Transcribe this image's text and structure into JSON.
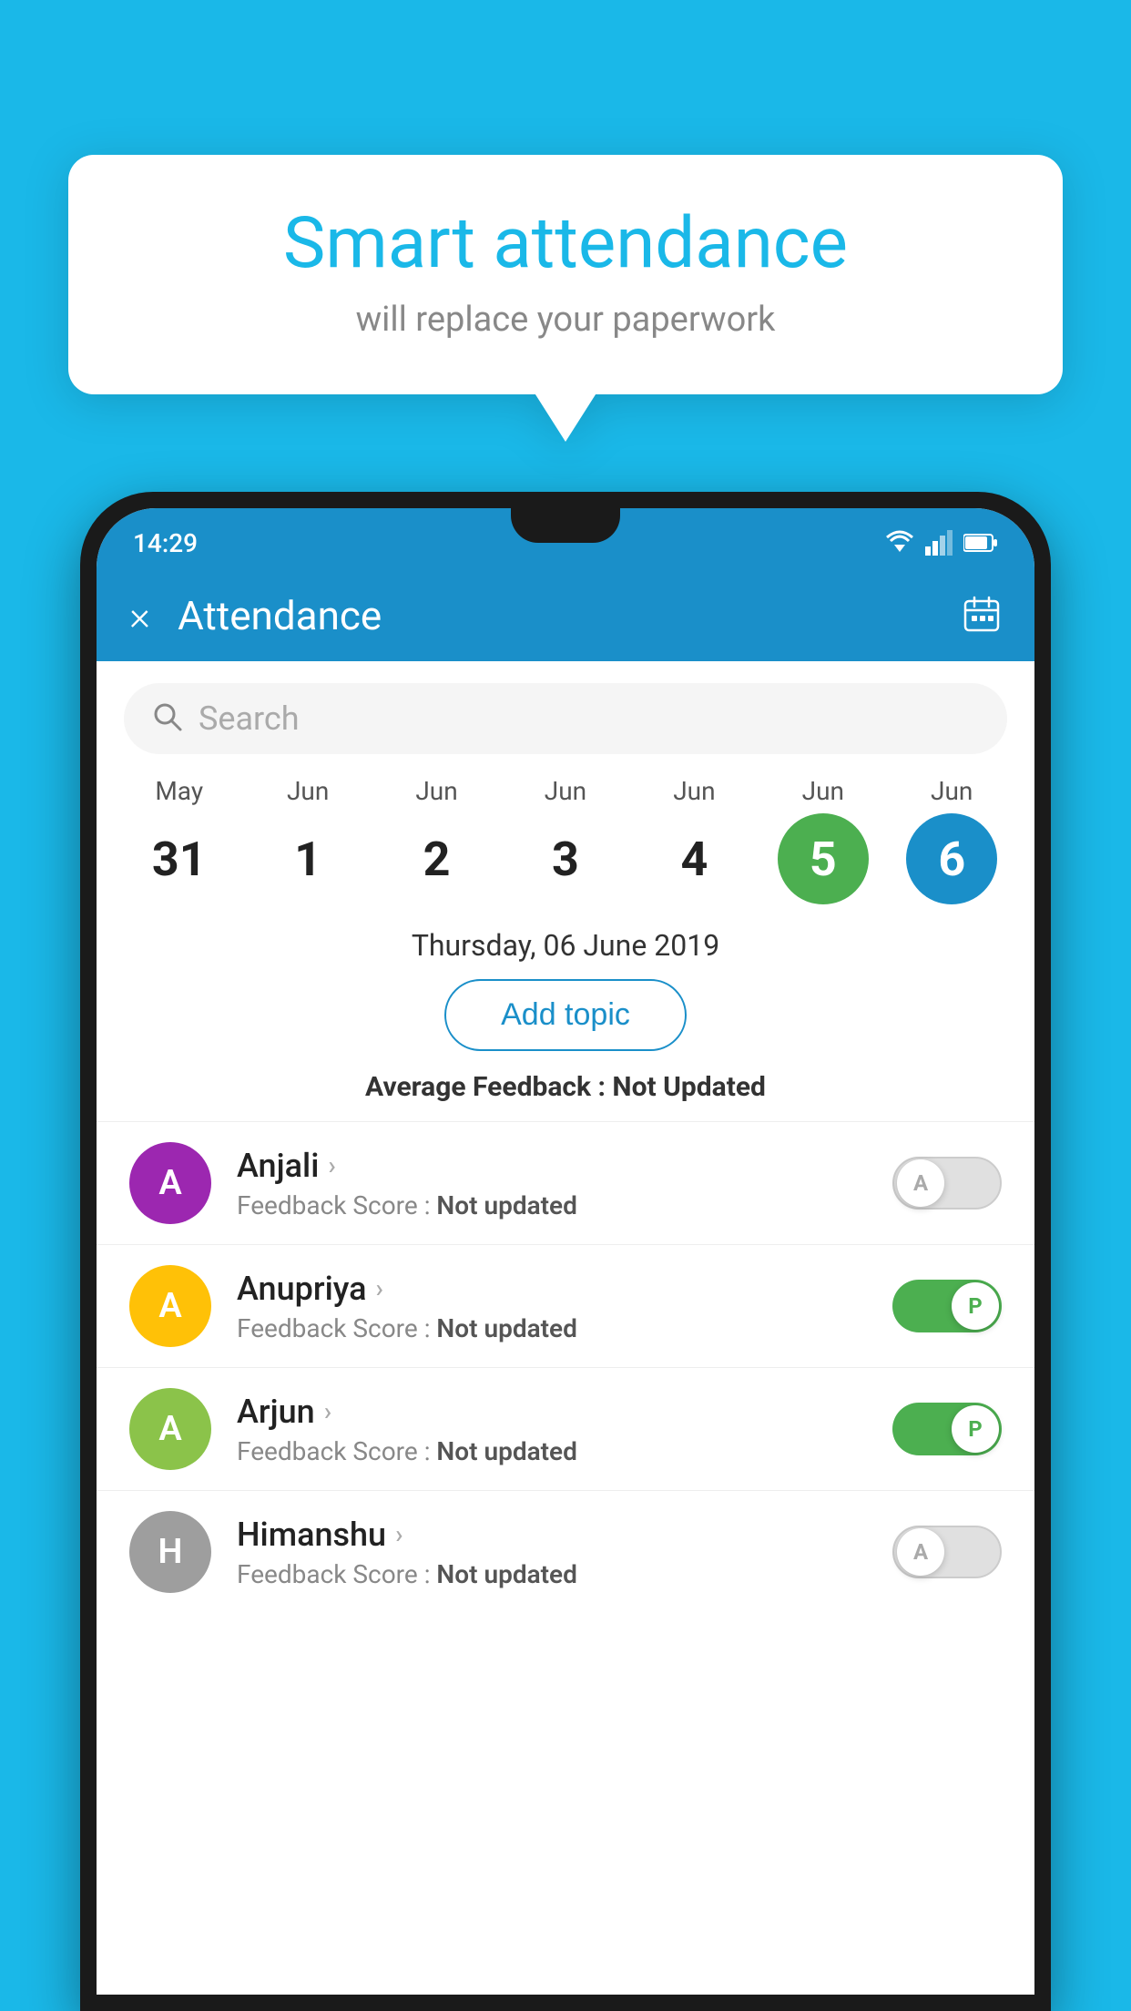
{
  "background": {
    "color": "#1ab8e8"
  },
  "bubble": {
    "title": "Smart attendance",
    "subtitle": "will replace your paperwork"
  },
  "status_bar": {
    "time": "14:29"
  },
  "header": {
    "title": "Attendance",
    "close_label": "×",
    "calendar_icon": "calendar-icon"
  },
  "search": {
    "placeholder": "Search"
  },
  "calendar": {
    "days": [
      {
        "month": "May",
        "date": "31",
        "state": "normal"
      },
      {
        "month": "Jun",
        "date": "1",
        "state": "normal"
      },
      {
        "month": "Jun",
        "date": "2",
        "state": "normal"
      },
      {
        "month": "Jun",
        "date": "3",
        "state": "normal"
      },
      {
        "month": "Jun",
        "date": "4",
        "state": "normal"
      },
      {
        "month": "Jun",
        "date": "5",
        "state": "green"
      },
      {
        "month": "Jun",
        "date": "6",
        "state": "blue"
      }
    ],
    "selected_date": "Thursday, 06 June 2019"
  },
  "add_topic": {
    "label": "Add topic"
  },
  "avg_feedback": {
    "label": "Average Feedback : ",
    "value": "Not Updated"
  },
  "students": [
    {
      "name": "Anjali",
      "avatar_letter": "A",
      "avatar_color": "#9c27b0",
      "feedback": "Feedback Score : ",
      "feedback_value": "Not updated",
      "toggle_state": "off",
      "toggle_letter": "A"
    },
    {
      "name": "Anupriya",
      "avatar_letter": "A",
      "avatar_color": "#ffc107",
      "feedback": "Feedback Score : ",
      "feedback_value": "Not updated",
      "toggle_state": "on",
      "toggle_letter": "P"
    },
    {
      "name": "Arjun",
      "avatar_letter": "A",
      "avatar_color": "#8bc34a",
      "feedback": "Feedback Score : ",
      "feedback_value": "Not updated",
      "toggle_state": "on",
      "toggle_letter": "P"
    },
    {
      "name": "Himanshu",
      "avatar_letter": "H",
      "avatar_color": "#9e9e9e",
      "feedback": "Feedback Score : ",
      "feedback_value": "Not updated",
      "toggle_state": "off",
      "toggle_letter": "A"
    }
  ]
}
